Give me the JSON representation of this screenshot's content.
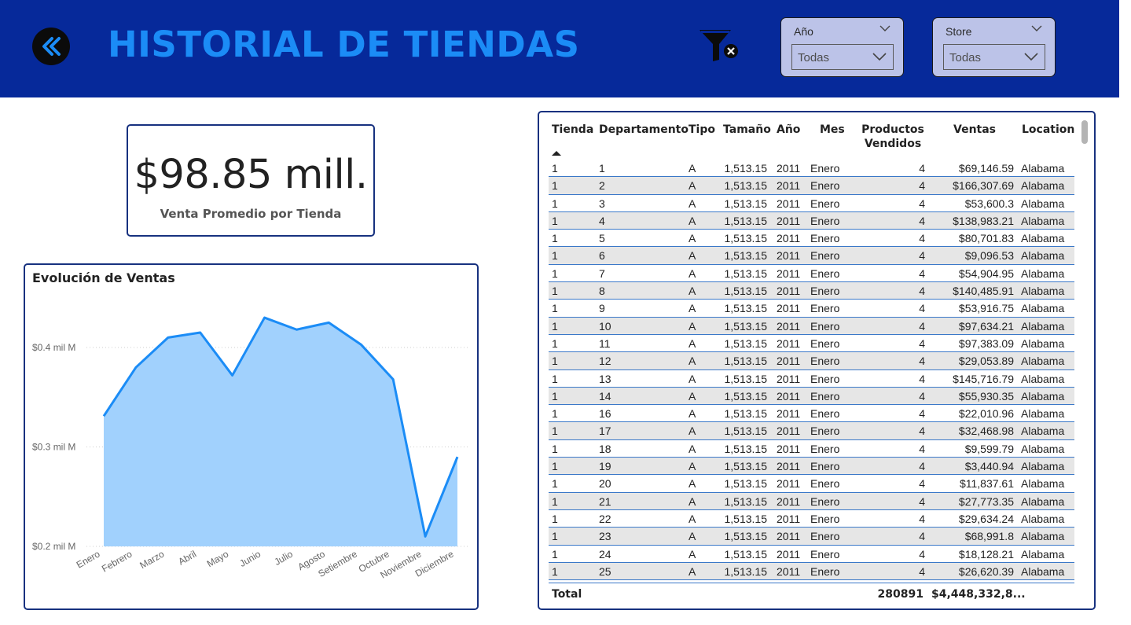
{
  "header": {
    "title": "HISTORIAL DE TIENDAS",
    "slicers": [
      {
        "label": "Año",
        "value": "Todas"
      },
      {
        "label": "Store",
        "value": "Todas"
      }
    ]
  },
  "kpi": {
    "value": "$98.85 mill.",
    "caption": "Venta Promedio por Tienda"
  },
  "chart": {
    "title": "Evolución de Ventas"
  },
  "chart_data": {
    "type": "area",
    "title": "Evolución de Ventas",
    "categories": [
      "Enero",
      "Febrero",
      "Marzo",
      "Abril",
      "Mayo",
      "Junio",
      "Julio",
      "Agosto",
      "Setiembre",
      "Octubre",
      "Noviembre",
      "Diciembre"
    ],
    "values": [
      0.331,
      0.38,
      0.41,
      0.415,
      0.372,
      0.43,
      0.418,
      0.425,
      0.403,
      0.368,
      0.21,
      0.29
    ],
    "yticks": [
      0.2,
      0.3,
      0.4
    ],
    "ytick_labels": [
      "$0.2 mil M",
      "$0.3 mil M",
      "$0.4 mil M"
    ],
    "ylim": [
      0.2,
      0.45
    ],
    "color": "#1b8cf6",
    "fill": "#a1d1fd",
    "grid": true
  },
  "table": {
    "columns": [
      "Tienda",
      "Departamento",
      "Tipo",
      "Tamaño",
      "Año",
      "Mes",
      "Productos Vendidos",
      "Ventas",
      "Location"
    ],
    "rows": [
      [
        "1",
        "1",
        "A",
        "1,513.15",
        "2011",
        "Enero",
        "4",
        "$69,146.59",
        "Alabama"
      ],
      [
        "1",
        "2",
        "A",
        "1,513.15",
        "2011",
        "Enero",
        "4",
        "$166,307.69",
        "Alabama"
      ],
      [
        "1",
        "3",
        "A",
        "1,513.15",
        "2011",
        "Enero",
        "4",
        "$53,600.3",
        "Alabama"
      ],
      [
        "1",
        "4",
        "A",
        "1,513.15",
        "2011",
        "Enero",
        "4",
        "$138,983.21",
        "Alabama"
      ],
      [
        "1",
        "5",
        "A",
        "1,513.15",
        "2011",
        "Enero",
        "4",
        "$80,701.83",
        "Alabama"
      ],
      [
        "1",
        "6",
        "A",
        "1,513.15",
        "2011",
        "Enero",
        "4",
        "$9,096.53",
        "Alabama"
      ],
      [
        "1",
        "7",
        "A",
        "1,513.15",
        "2011",
        "Enero",
        "4",
        "$54,904.95",
        "Alabama"
      ],
      [
        "1",
        "8",
        "A",
        "1,513.15",
        "2011",
        "Enero",
        "4",
        "$140,485.91",
        "Alabama"
      ],
      [
        "1",
        "9",
        "A",
        "1,513.15",
        "2011",
        "Enero",
        "4",
        "$53,916.75",
        "Alabama"
      ],
      [
        "1",
        "10",
        "A",
        "1,513.15",
        "2011",
        "Enero",
        "4",
        "$97,634.21",
        "Alabama"
      ],
      [
        "1",
        "11",
        "A",
        "1,513.15",
        "2011",
        "Enero",
        "4",
        "$97,383.09",
        "Alabama"
      ],
      [
        "1",
        "12",
        "A",
        "1,513.15",
        "2011",
        "Enero",
        "4",
        "$29,053.89",
        "Alabama"
      ],
      [
        "1",
        "13",
        "A",
        "1,513.15",
        "2011",
        "Enero",
        "4",
        "$145,716.79",
        "Alabama"
      ],
      [
        "1",
        "14",
        "A",
        "1,513.15",
        "2011",
        "Enero",
        "4",
        "$55,930.35",
        "Alabama"
      ],
      [
        "1",
        "16",
        "A",
        "1,513.15",
        "2011",
        "Enero",
        "4",
        "$22,010.96",
        "Alabama"
      ],
      [
        "1",
        "17",
        "A",
        "1,513.15",
        "2011",
        "Enero",
        "4",
        "$32,468.98",
        "Alabama"
      ],
      [
        "1",
        "18",
        "A",
        "1,513.15",
        "2011",
        "Enero",
        "4",
        "$9,599.79",
        "Alabama"
      ],
      [
        "1",
        "19",
        "A",
        "1,513.15",
        "2011",
        "Enero",
        "4",
        "$3,440.94",
        "Alabama"
      ],
      [
        "1",
        "20",
        "A",
        "1,513.15",
        "2011",
        "Enero",
        "4",
        "$11,837.61",
        "Alabama"
      ],
      [
        "1",
        "21",
        "A",
        "1,513.15",
        "2011",
        "Enero",
        "4",
        "$27,773.35",
        "Alabama"
      ],
      [
        "1",
        "22",
        "A",
        "1,513.15",
        "2011",
        "Enero",
        "4",
        "$29,634.24",
        "Alabama"
      ],
      [
        "1",
        "23",
        "A",
        "1,513.15",
        "2011",
        "Enero",
        "4",
        "$68,991.8",
        "Alabama"
      ],
      [
        "1",
        "24",
        "A",
        "1,513.15",
        "2011",
        "Enero",
        "4",
        "$18,128.21",
        "Alabama"
      ],
      [
        "1",
        "25",
        "A",
        "1,513.15",
        "2011",
        "Enero",
        "4",
        "$26,620.39",
        "Alabama"
      ]
    ],
    "total_label": "Total",
    "total_products": "280891",
    "total_sales": "$4,448,332,8..."
  },
  "icons": {
    "back": "double-chevron-left-icon",
    "clear_filters": "filter-clear-icon",
    "sort": "sort-ascending-icon"
  }
}
